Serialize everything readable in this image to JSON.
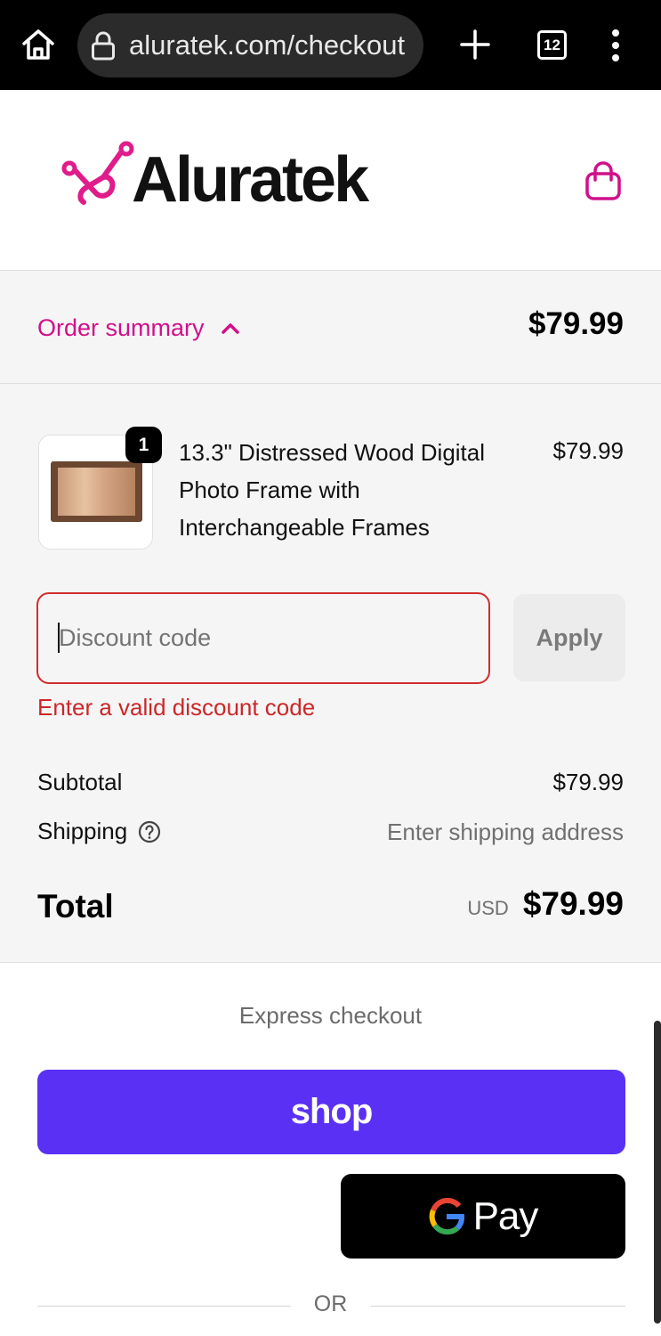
{
  "browser": {
    "url": "aluratek.com/checkout",
    "tab_count": "12",
    "icons": [
      "home-icon",
      "lock-icon",
      "plus-icon",
      "tabs-icon",
      "more-icon"
    ]
  },
  "header": {
    "logo_text": "Aluratek",
    "cart_icon": "shopping-bag-icon",
    "brand_color": "#d10f8a"
  },
  "summary_bar": {
    "toggle_label": "Order summary",
    "total": "$79.99"
  },
  "line_item": {
    "quantity": "1",
    "name": "13.3\" Distressed Wood Digital Photo Frame with Interchangeable Frames",
    "price": "$79.99"
  },
  "discount": {
    "placeholder": "Discount code",
    "value": "",
    "apply_label": "Apply",
    "error": "Enter a valid discount code"
  },
  "totals": {
    "subtotal_label": "Subtotal",
    "subtotal_value": "$79.99",
    "shipping_label": "Shipping",
    "shipping_value": "Enter shipping address",
    "total_label": "Total",
    "currency": "USD",
    "total_value": "$79.99"
  },
  "express": {
    "title": "Express checkout",
    "shop_label": "shop",
    "gpay_label": "Pay",
    "or_label": "OR",
    "shop_color": "#5a31f4"
  }
}
